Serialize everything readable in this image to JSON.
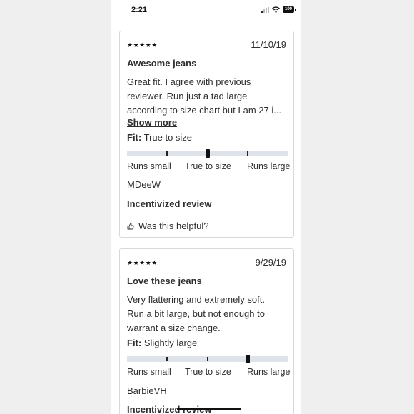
{
  "status": {
    "time": "2:21",
    "battery": "100"
  },
  "reviews": [
    {
      "rating": 5,
      "stars": "★★★★★",
      "date": "11/10/19",
      "title": "Awesome jeans",
      "body_lines": [
        "Great fit. I agree with previous",
        "reviewer. Run just a tad large",
        "according to size chart but I am 27 i..."
      ],
      "show_more": "Show more",
      "fit_label": "Fit:",
      "fit_value": "True to size",
      "fit_position": 0.5,
      "scale_labels": [
        "Runs small",
        "True to size",
        "Runs large"
      ],
      "reviewer": "MDeeW",
      "incentivized": "Incentivized review",
      "helpful": "Was this helpful?"
    },
    {
      "rating": 5,
      "stars": "★★★★★",
      "date": "9/29/19",
      "title": "Love these jeans",
      "body_lines": [
        "Very flattering and extremely soft.",
        "Run a bit large, but not enough to",
        "warrant a size change."
      ],
      "fit_label": "Fit:",
      "fit_value": "Slightly large",
      "fit_position": 0.75,
      "scale_labels": [
        "Runs small",
        "True to size",
        "Runs large"
      ],
      "reviewer": "BarbieVH",
      "incentivized": "Incentivized review"
    }
  ]
}
